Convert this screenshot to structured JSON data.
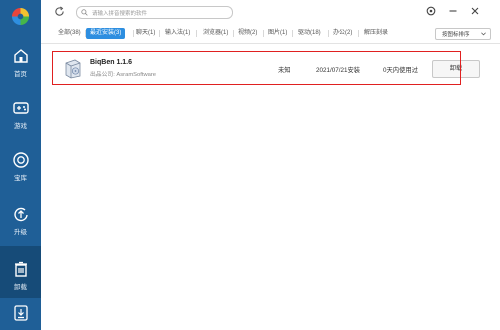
{
  "sidebar": {
    "items": [
      {
        "label": "首页",
        "icon": "home-icon"
      },
      {
        "label": "游戏",
        "icon": "gamepad-icon"
      },
      {
        "label": "宝库",
        "icon": "treasure-icon"
      },
      {
        "label": "升级",
        "icon": "upgrade-icon"
      },
      {
        "label": "卸载",
        "icon": "trash-icon",
        "active": true
      },
      {
        "label": "",
        "icon": "download-icon"
      }
    ]
  },
  "search": {
    "placeholder": "请输入拼音搜索的软件"
  },
  "tabs": [
    {
      "label": "全部(38)"
    },
    {
      "label": "最近安装(3)",
      "active": true
    },
    {
      "label": "聊天(1)"
    },
    {
      "label": "输入法(1)"
    },
    {
      "label": "浏览器(1)"
    },
    {
      "label": "视频(2)"
    },
    {
      "label": "图片(1)"
    },
    {
      "label": "驱动(18)"
    },
    {
      "label": "办公(2)"
    },
    {
      "label": "解压刻录"
    }
  ],
  "sort_label": "按图标排序",
  "apps": [
    {
      "name": "BiqBen 1.1.6",
      "publisher": "出品公司: AsramSoftware",
      "size": "未知",
      "install_date": "2021/07/21安装",
      "last_used": "0天内使用过",
      "action": "卸载"
    }
  ],
  "colors": {
    "sidebar": "#1f5f97",
    "sidebar_active": "#164b78",
    "accent": "#2d8ee0",
    "highlight": "#e02020"
  }
}
